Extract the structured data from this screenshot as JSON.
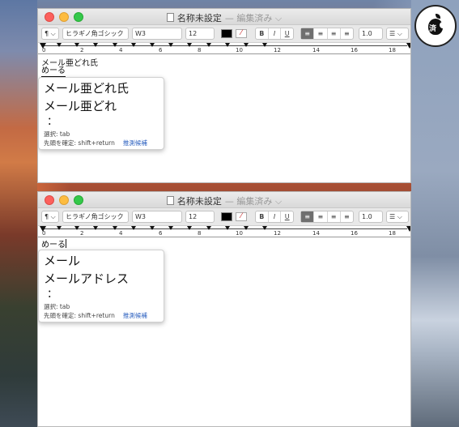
{
  "badge": {
    "label": "済"
  },
  "window1": {
    "title": "名称未設定",
    "edited": "— 編集済み ⌵",
    "toolbar": {
      "paragraph": "¶ ⌵",
      "font": "ヒラギノ角ゴシック",
      "weight": "W3",
      "size": "12",
      "bold": "B",
      "italic": "I",
      "underline": "U",
      "spacing": "1.0",
      "list": "☰ ⌵"
    },
    "ruler": [
      "0",
      "2",
      "4",
      "6",
      "8",
      "10",
      "12",
      "14",
      "16",
      "18"
    ],
    "text_line": "メール亜どれ氏",
    "composing": "めーる",
    "candidates": [
      "メール亜どれ氏",
      "メール亜どれ",
      "："
    ],
    "hint_select": "選択: tab",
    "hint_confirm": "先頭を確定: shift+return",
    "hint_predict": "推測候補"
  },
  "window2": {
    "title": "名称未設定",
    "edited": "— 編集済み ⌵",
    "toolbar": {
      "paragraph": "¶ ⌵",
      "font": "ヒラギノ角ゴシック",
      "weight": "W3",
      "size": "12",
      "bold": "B",
      "italic": "I",
      "underline": "U",
      "spacing": "1.0",
      "list": "☰ ⌵"
    },
    "ruler": [
      "0",
      "2",
      "4",
      "6",
      "8",
      "10",
      "12",
      "14",
      "16",
      "18"
    ],
    "composing": "めーる",
    "candidates": [
      "メール",
      "メールアドレス",
      "："
    ],
    "hint_select": "選択: tab",
    "hint_confirm": "先頭を確定: shift+return",
    "hint_predict": "推測候補"
  },
  "colors": {
    "accent_link": "#2a5fbf",
    "close": "#fc605c",
    "minimize": "#fdbc40",
    "zoom": "#34c84a"
  }
}
